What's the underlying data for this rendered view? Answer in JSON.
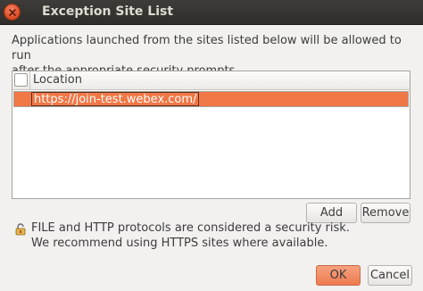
{
  "window": {
    "title": "Exception Site List"
  },
  "description": {
    "line1": "Applications launched from the sites listed below will be allowed to run",
    "line2": "after the appropriate security prompts."
  },
  "table": {
    "column_header": "Location",
    "rows": [
      {
        "location": "https://join-test.webex.com/",
        "selected": true
      }
    ]
  },
  "buttons": {
    "add": "Add",
    "remove": "Remove",
    "ok": "OK",
    "cancel": "Cancel"
  },
  "warning": {
    "line1": "FILE and HTTP protocols are considered a security risk.",
    "line2": "We recommend using HTTPS sites where available.",
    "icon": "lock-icon"
  },
  "colors": {
    "accent": "#f07746",
    "titlebar": "#3d3c38"
  }
}
